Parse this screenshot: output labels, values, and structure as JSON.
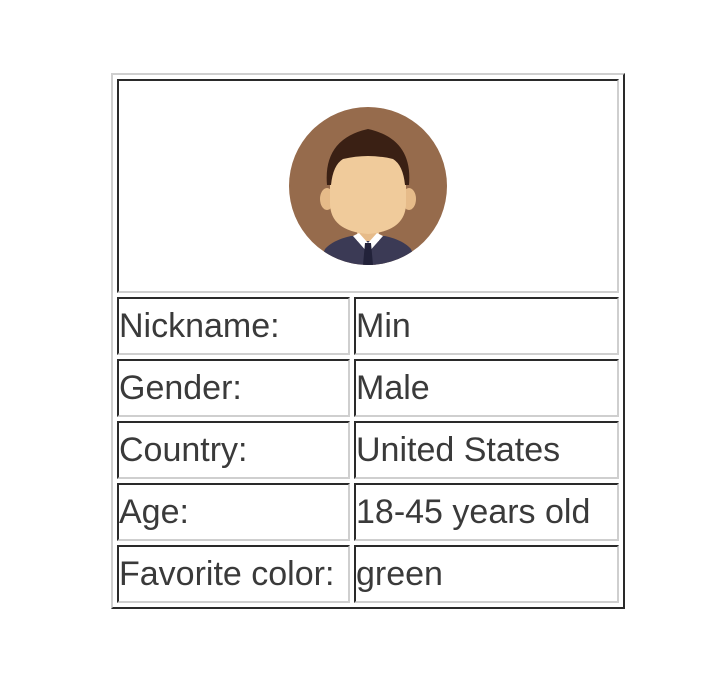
{
  "avatar": {
    "icon": "user-avatar-icon",
    "colors": {
      "background": "#966b4c",
      "skin": "#f0cb9b",
      "hair": "#3a2014",
      "suit": "#3b3a55",
      "shirt": "#ffffff",
      "tie": "#22223a"
    }
  },
  "profile": {
    "rows": [
      {
        "label": "Nickname:",
        "value": "Min"
      },
      {
        "label": "Gender:",
        "value": "Male"
      },
      {
        "label": "Country:",
        "value": "United States"
      },
      {
        "label": "Age:",
        "value": "18-45 years old"
      },
      {
        "label": "Favorite color:",
        "value": "green"
      }
    ]
  }
}
